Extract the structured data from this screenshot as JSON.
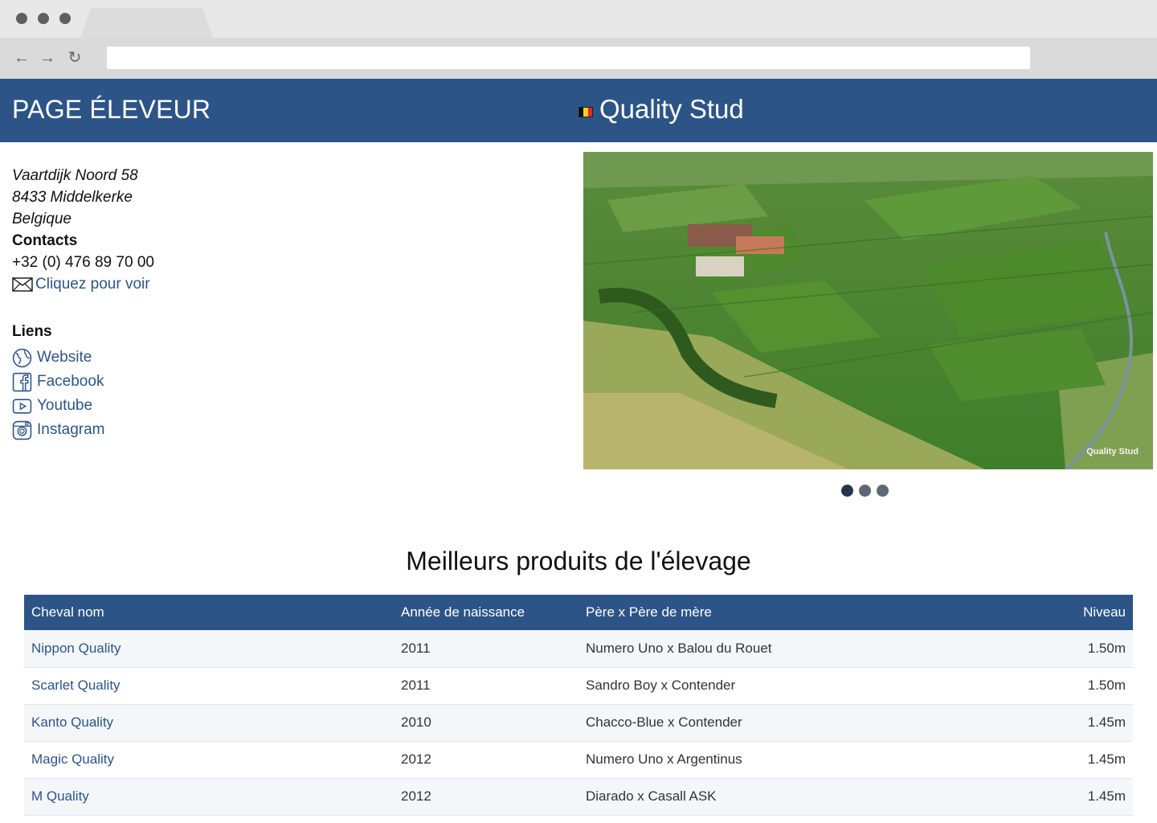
{
  "header": {
    "page_title": "PAGE ÉLEVEUR",
    "stud_name": "Quality Stud",
    "flag": "belgium-flag",
    "band_color": "#2d5486"
  },
  "info": {
    "address_line1": "Vaartdijk Noord 58",
    "address_line2": "8433 Middelkerke",
    "address_line3": "Belgique",
    "contacts_label": "Contacts",
    "phone": "+32 (0) 476 89 70 00",
    "email_link": "Cliquez pour voir"
  },
  "links": {
    "title": "Liens",
    "items": [
      {
        "label": "Website",
        "icon": "globe-icon"
      },
      {
        "label": "Facebook",
        "icon": "facebook-icon"
      },
      {
        "label": "Youtube",
        "icon": "youtube-icon"
      },
      {
        "label": "Instagram",
        "icon": "instagram-icon"
      }
    ]
  },
  "photo": {
    "caption": "Quality Stud",
    "carousel_count": 3,
    "carousel_active": 1
  },
  "products": {
    "title": "Meilleurs produits de l'élevage",
    "columns": [
      "Cheval nom",
      "Année de naissance",
      "Père x Père de mère",
      "Niveau"
    ],
    "rows": [
      [
        "Nippon Quality",
        "2011",
        "Numero Uno x Balou du Rouet",
        "1.50m"
      ],
      [
        "Scarlet Quality",
        "2011",
        "Sandro Boy x Contender",
        "1.50m"
      ],
      [
        "Kanto Quality",
        "2010",
        "Chacco-Blue x Contender",
        "1.45m"
      ],
      [
        "Magic Quality",
        "2012",
        "Numero Uno x Argentinus",
        "1.45m"
      ],
      [
        "M Quality",
        "2012",
        "Diarado x Casall ASK",
        "1.45m"
      ]
    ]
  }
}
